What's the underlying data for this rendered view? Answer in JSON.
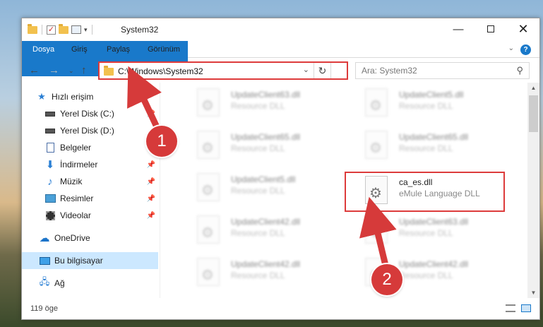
{
  "window": {
    "title": "System32",
    "qat_separator": "|",
    "controls": {
      "minimize": "—",
      "close": "✕"
    }
  },
  "ribbon": {
    "tabs": [
      "Dosya",
      "Giriş",
      "Paylaş",
      "Görünüm"
    ],
    "expand": "⌄",
    "help": "?"
  },
  "nav": {
    "back": "←",
    "forward": "→",
    "recent": "⌄",
    "up": "↑",
    "address": "C:\\Windows\\System32",
    "address_chevron": "⌄",
    "refresh": "↻",
    "search_placeholder": "Ara: System32",
    "search_icon": "⚲"
  },
  "sidebar": {
    "items": [
      {
        "label": "Hızlı erişim",
        "icon": "star-icon"
      },
      {
        "label": "Yerel Disk (C:)",
        "icon": "drive-icon",
        "pinned": true
      },
      {
        "label": "Yerel Disk (D:)",
        "icon": "drive-icon"
      },
      {
        "label": "Belgeler",
        "icon": "documents-icon"
      },
      {
        "label": "İndirmeler",
        "icon": "download-icon",
        "pinned": true
      },
      {
        "label": "Müzik",
        "icon": "music-icon",
        "pinned": true
      },
      {
        "label": "Resimler",
        "icon": "pictures-icon",
        "pinned": true
      },
      {
        "label": "Videolar",
        "icon": "videos-icon",
        "pinned": true
      },
      {
        "label": "OneDrive",
        "icon": "cloud-icon"
      },
      {
        "label": "Bu bilgisayar",
        "icon": "computer-icon",
        "selected": true
      },
      {
        "label": "Ağ",
        "icon": "network-icon"
      }
    ]
  },
  "files": [
    {
      "name": "UpdateClient63.dll",
      "type": "Resource DLL"
    },
    {
      "name": "UpdateClient5.dll",
      "type": "Resource DLL"
    },
    {
      "name": "UpdateClient65.dll",
      "type": "Resource DLL"
    },
    {
      "name": "UpdateClient65.dll",
      "type": "Resource DLL"
    },
    {
      "name": "UpdateClient5.dll",
      "type": "Resource DLL"
    },
    {
      "name": "ca_es.dll",
      "type": "eMule Language DLL",
      "highlighted": true
    },
    {
      "name": "UpdateClient42.dll",
      "type": "Resource DLL"
    },
    {
      "name": "UpdateClient63.dll",
      "type": "Resource DLL"
    },
    {
      "name": "UpdateClient42.dll",
      "type": "Resource DLL"
    },
    {
      "name": "UpdateClient42.dll",
      "type": "Resource DLL"
    }
  ],
  "status": {
    "item_count": "119 öge"
  },
  "annotations": {
    "step1": "1",
    "step2": "2",
    "color": "#d63a3a"
  },
  "accent": "#1979ca"
}
